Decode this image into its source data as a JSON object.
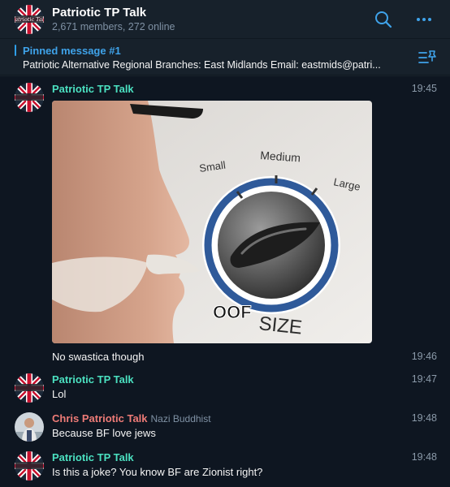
{
  "chat": {
    "title": "Patriotic TP Talk",
    "subtitle": "2,671 members, 272 online"
  },
  "pinned": {
    "title": "Pinned message #1",
    "text": "Patriotic Alternative Regional Branches:  East Midlands Email: eastmids@patri..."
  },
  "avatar_text": "Patriotic Talk",
  "messages": [
    {
      "sender": "Patriotic TP Talk",
      "time": "19:45",
      "image": {
        "labels": [
          "Small",
          "Medium",
          "Large",
          "OOF",
          "SIZE"
        ]
      }
    },
    {
      "sender": "",
      "time": "19:46",
      "text": "No swastica though"
    },
    {
      "sender": "Patriotic TP Talk",
      "time": "19:47",
      "text": "Lol"
    },
    {
      "sender": "Chris Patriotic Talk",
      "role": "Nazi Buddhist",
      "time": "19:48",
      "text": "Because BF love jews"
    },
    {
      "sender": "Patriotic TP Talk",
      "time": "19:48",
      "text": "Is this a joke? You know BF are Zionist right?"
    }
  ],
  "colors": {
    "accent": "#3fa3ea",
    "sender_green": "#4be0c0",
    "sender_red": "#ee7b77"
  },
  "icons": {
    "search": "search-icon",
    "more": "more-icon",
    "pinned_list": "pinned-list-icon"
  }
}
